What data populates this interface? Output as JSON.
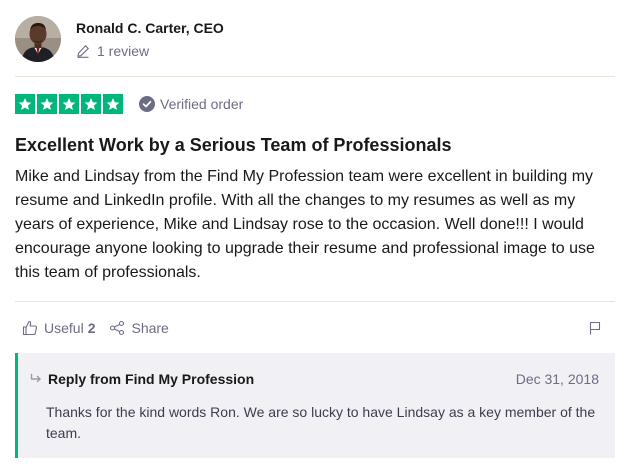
{
  "reviewer": {
    "name": "Ronald C. Carter, CEO",
    "review_count": "1 review"
  },
  "rating": {
    "stars": 5,
    "max_stars": 5,
    "verified_label": "Verified order",
    "star_color": "#00b67a"
  },
  "review": {
    "title": "Excellent Work by a Serious Team of Professionals",
    "body": "Mike and Lindsay from the Find My Profession team were excellent in building my resume and LinkedIn profile. With all the changes to my resumes as well as my years of experience, Mike and Lindsay rose to the occasion. Well done!!! I would encourage anyone looking to upgrade their resume and professional image to use this team of professionals."
  },
  "actions": {
    "useful_label": "Useful",
    "useful_count": "2",
    "share_label": "Share"
  },
  "reply": {
    "title": "Reply from Find My Profession",
    "date": "Dec 31, 2018",
    "text": "Thanks for the kind words Ron. We are so lucky to have Lindsay as a key member of the team.",
    "accent_color": "#00b67a"
  },
  "icons": [
    "avatar",
    "pencil-icon",
    "star-icon",
    "verified-check-icon",
    "thumbs-up-icon",
    "share-icon",
    "flag-icon",
    "reply-arrow-icon"
  ]
}
